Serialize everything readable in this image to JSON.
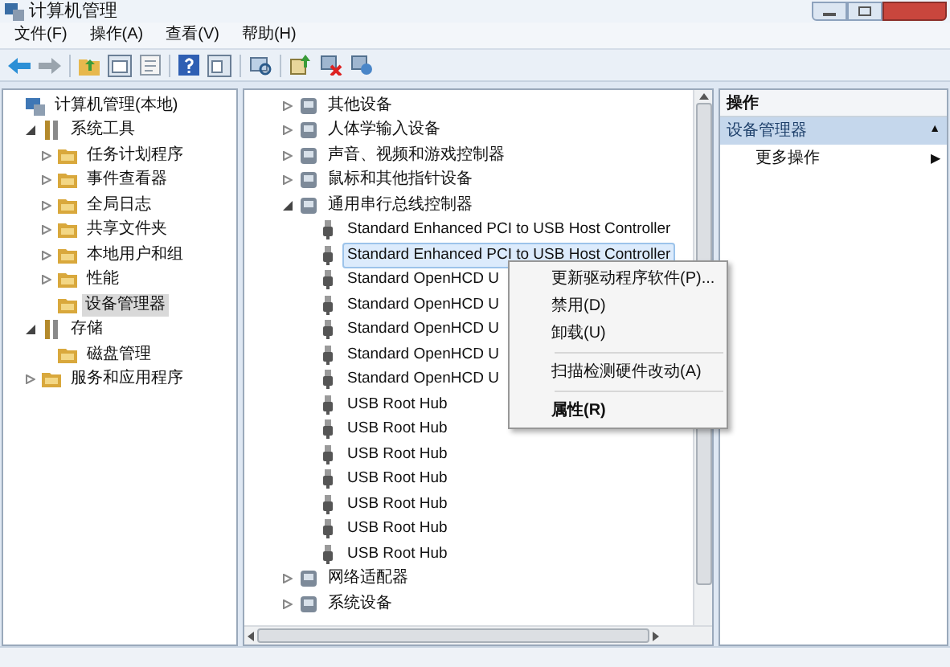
{
  "window": {
    "title": "计算机管理"
  },
  "menu": [
    {
      "label": "文件(F)"
    },
    {
      "label": "操作(A)"
    },
    {
      "label": "查看(V)"
    },
    {
      "label": "帮助(H)"
    }
  ],
  "left_tree": [
    {
      "label": "计算机管理(本地)",
      "selected": false,
      "children": [
        {
          "label": "系统工具",
          "expanded": true,
          "selected": false,
          "children": [
            {
              "label": "任务计划程序",
              "expanded": false,
              "selected": false
            },
            {
              "label": "事件查看器",
              "expanded": false,
              "selected": false
            },
            {
              "label": "全局日志",
              "expanded": false,
              "selected": false
            },
            {
              "label": "共享文件夹",
              "expanded": false,
              "selected": false
            },
            {
              "label": "本地用户和组",
              "expanded": false,
              "selected": false
            },
            {
              "label": "性能",
              "expanded": false,
              "selected": false
            },
            {
              "label": "设备管理器",
              "selected": true
            }
          ]
        },
        {
          "label": "存储",
          "expanded": true,
          "selected": false,
          "children": [
            {
              "label": "磁盘管理",
              "selected": false
            }
          ]
        },
        {
          "label": "服务和应用程序",
          "expanded": false,
          "selected": false
        }
      ]
    }
  ],
  "device_tree": [
    {
      "label": "其他设备",
      "expanded": false,
      "selected": false
    },
    {
      "label": "人体学输入设备",
      "expanded": false,
      "selected": false
    },
    {
      "label": "声音、视频和游戏控制器",
      "expanded": false,
      "selected": false
    },
    {
      "label": "鼠标和其他指针设备",
      "expanded": false,
      "selected": false
    },
    {
      "label": "通用串行总线控制器",
      "expanded": true,
      "selected": false,
      "children": [
        {
          "label": "Standard Enhanced PCI to USB Host Controller",
          "selected": false
        },
        {
          "label": "Standard Enhanced PCI to USB Host Controller",
          "selected": true
        },
        {
          "label": "Standard OpenHCD U",
          "selected": false
        },
        {
          "label": "Standard OpenHCD U",
          "selected": false
        },
        {
          "label": "Standard OpenHCD U",
          "selected": false
        },
        {
          "label": "Standard OpenHCD U",
          "selected": false
        },
        {
          "label": "Standard OpenHCD U",
          "selected": false
        },
        {
          "label": "USB Root Hub",
          "selected": false
        },
        {
          "label": "USB Root Hub",
          "selected": false
        },
        {
          "label": "USB Root Hub",
          "selected": false
        },
        {
          "label": "USB Root Hub",
          "selected": false
        },
        {
          "label": "USB Root Hub",
          "selected": false
        },
        {
          "label": "USB Root Hub",
          "selected": false
        },
        {
          "label": "USB Root Hub",
          "selected": false
        }
      ]
    },
    {
      "label": "网络适配器",
      "expanded": false,
      "selected": false
    },
    {
      "label": "系统设备",
      "expanded": false,
      "selected": false
    }
  ],
  "context_menu": [
    {
      "kind": "item",
      "label": "更新驱动程序软件(P)...",
      "bold": false
    },
    {
      "kind": "item",
      "label": "禁用(D)",
      "bold": false
    },
    {
      "kind": "item",
      "label": "卸载(U)",
      "bold": false
    },
    {
      "kind": "separator"
    },
    {
      "kind": "item",
      "label": "扫描检测硬件改动(A)",
      "bold": false
    },
    {
      "kind": "separator"
    },
    {
      "kind": "item",
      "label": "属性(R)",
      "bold": true
    }
  ],
  "actions": {
    "header": "操作",
    "section": {
      "label": "设备管理器",
      "arrow": "▲"
    },
    "items": [
      {
        "label": "更多操作",
        "arrow": "▶"
      }
    ]
  }
}
